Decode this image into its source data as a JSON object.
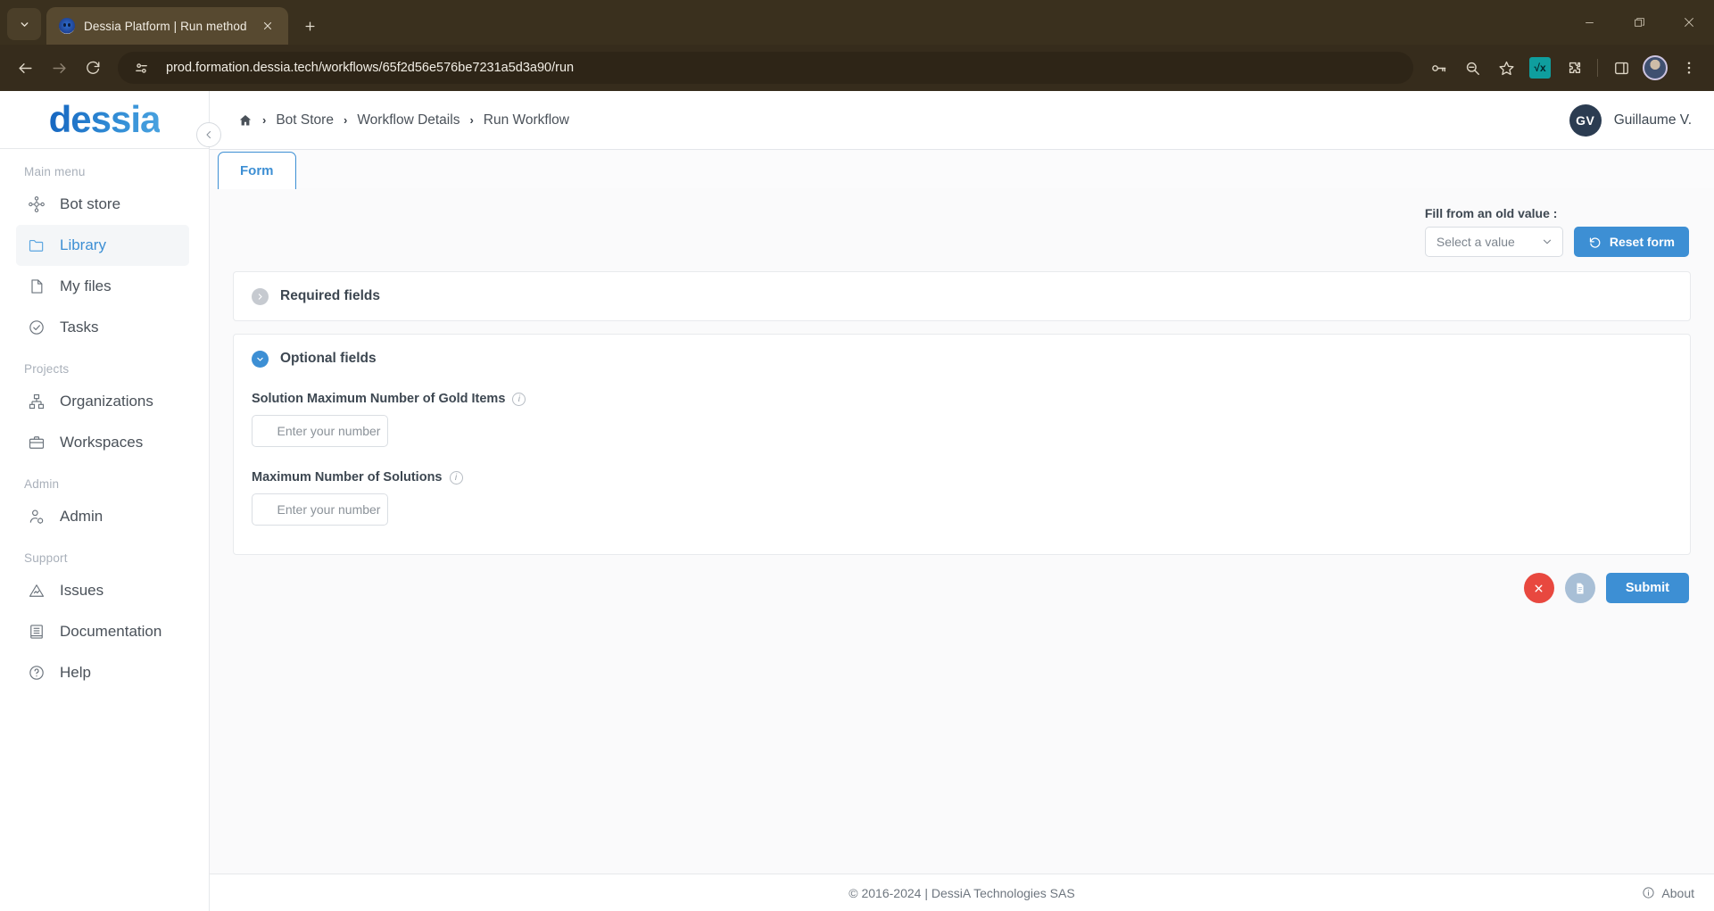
{
  "browser": {
    "tab": {
      "title": "Dessia Platform | Run method",
      "favicon": "dessia-favicon"
    },
    "new_tab_label": "+",
    "tab_list_icon": "chevron-down-icon",
    "close_icon": "×",
    "nav": {
      "back": "back-icon",
      "forward": "forward-icon",
      "reload": "reload-icon"
    },
    "url": "prod.formation.dessia.tech/workflows/65f2d56e576be7231a5d3a90/run",
    "site_icon": "site-settings-icon",
    "right_icons": [
      "password-key-icon",
      "zoom-out-icon",
      "bookmark-star-icon",
      "math-extension-icon",
      "extensions-puzzle-icon",
      "side-panel-icon",
      "profile-avatar-icon",
      "browser-menu-icon"
    ],
    "math_ext_label": "√x",
    "window": {
      "minimize": "minimize-icon",
      "maximize": "restore-icon",
      "close": "close-icon"
    }
  },
  "sidebar": {
    "logo": "dessia",
    "collapse_icon": "chevron-left-icon",
    "groups": [
      {
        "title": "Main menu",
        "items": [
          {
            "label": "Bot store",
            "icon": "bot-store-icon",
            "active": false
          },
          {
            "label": "Library",
            "icon": "folder-icon",
            "active": true
          },
          {
            "label": "My files",
            "icon": "file-icon",
            "active": false
          },
          {
            "label": "Tasks",
            "icon": "check-circle-icon",
            "active": false
          }
        ]
      },
      {
        "title": "Projects",
        "items": [
          {
            "label": "Organizations",
            "icon": "org-chart-icon",
            "active": false
          },
          {
            "label": "Workspaces",
            "icon": "briefcase-icon",
            "active": false
          }
        ]
      },
      {
        "title": "Admin",
        "items": [
          {
            "label": "Admin",
            "icon": "user-gear-icon",
            "active": false
          }
        ]
      },
      {
        "title": "Support",
        "items": [
          {
            "label": "Issues",
            "icon": "warning-triangle-icon",
            "active": false
          },
          {
            "label": "Documentation",
            "icon": "book-icon",
            "active": false
          },
          {
            "label": "Help",
            "icon": "question-circle-icon",
            "active": false
          }
        ]
      }
    ]
  },
  "topbar": {
    "home_icon": "home-icon",
    "breadcrumb": [
      "Bot Store",
      "Workflow Details",
      "Run Workflow"
    ],
    "separator": "›",
    "user": {
      "initials": "GV",
      "name": "Guillaume V."
    }
  },
  "tabs": [
    {
      "label": "Form",
      "active": true
    }
  ],
  "fill_from_old": {
    "label": "Fill from an old value :",
    "select_value": "Select a value",
    "select_chevron": "chevron-down-icon",
    "reset_label": "Reset form",
    "reset_icon": "reset-arrow-icon"
  },
  "sections": [
    {
      "title": "Required fields",
      "expanded": false,
      "toggle_icon": "chevron-right-icon",
      "fields": []
    },
    {
      "title": "Optional fields",
      "expanded": true,
      "toggle_icon": "chevron-down-icon",
      "fields": [
        {
          "label": "Solution Maximum Number of Gold Items",
          "placeholder": "Enter your number",
          "value": "",
          "info_icon": "info-icon"
        },
        {
          "label": "Maximum Number of Solutions",
          "placeholder": "Enter your number",
          "value": "",
          "info_icon": "info-icon"
        }
      ]
    }
  ],
  "actions": {
    "cancel_icon": "close-x-icon",
    "document_icon": "document-icon",
    "submit_label": "Submit"
  },
  "footer": {
    "copyright": "© 2016-2024 | DessiA Technologies SAS",
    "about_label": "About",
    "about_icon": "info-icon"
  },
  "colors": {
    "accent_blue": "#3d8fd4",
    "danger_red": "#e8483f",
    "muted_blue": "#a8bfd6",
    "chrome_bg": "#362c1c"
  }
}
